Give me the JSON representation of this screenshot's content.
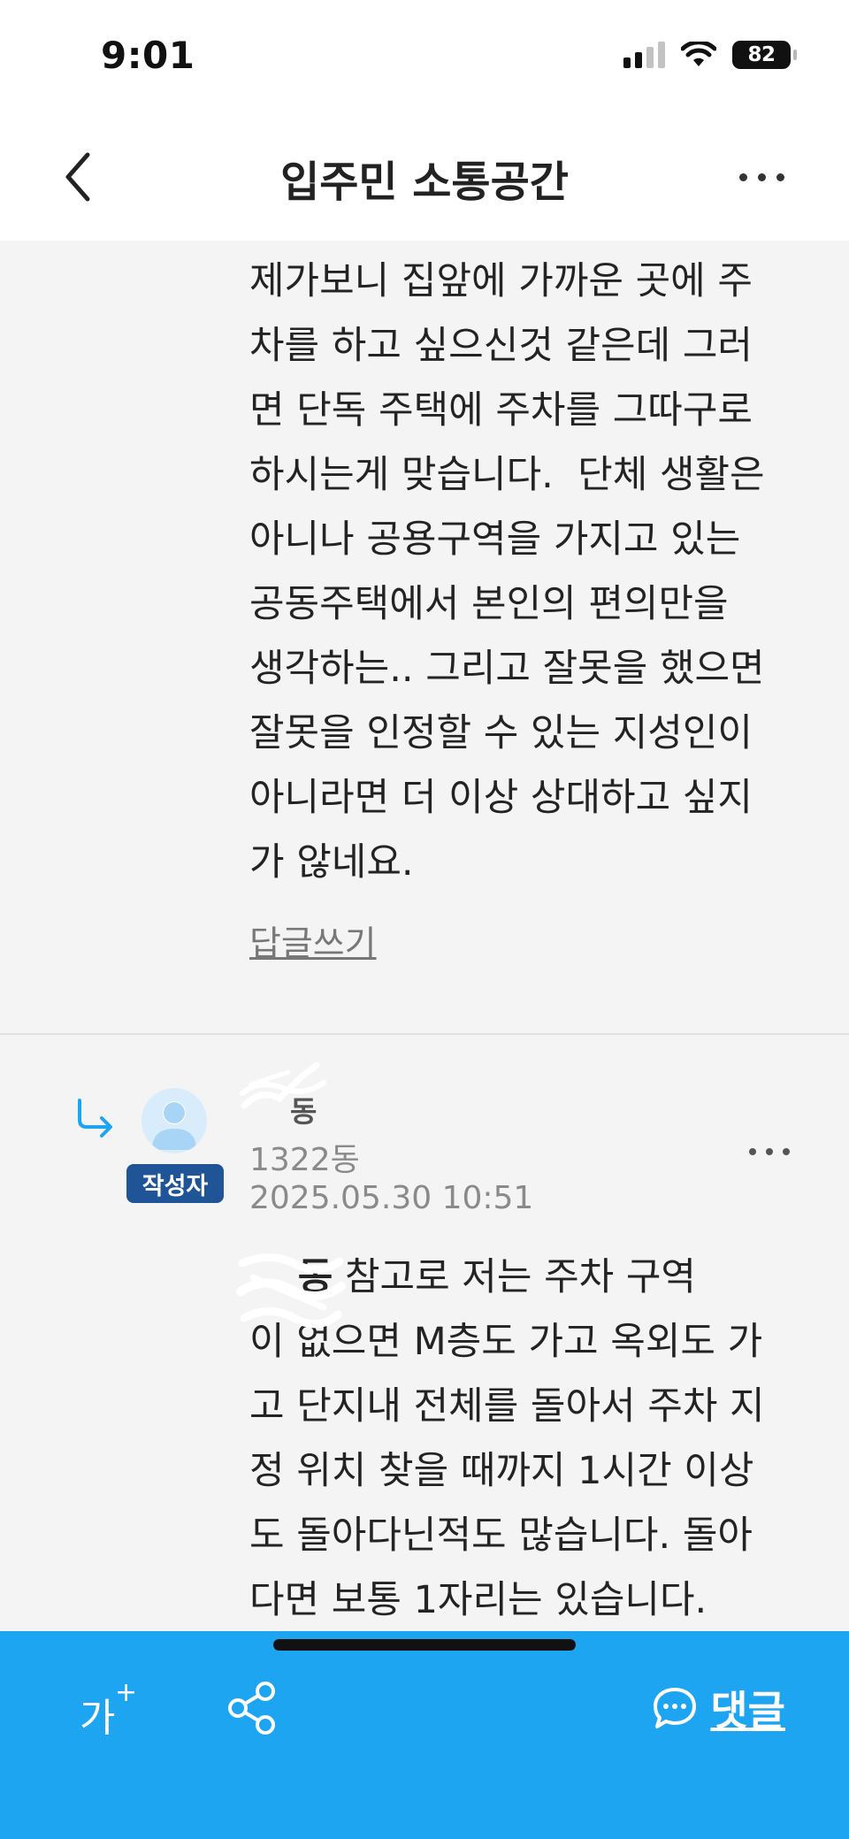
{
  "status_bar": {
    "time": "9:01",
    "battery": "82",
    "icons": [
      "signal-icon",
      "wifi-icon",
      "battery-icon"
    ]
  },
  "nav": {
    "title": "입주민 소통공간",
    "back_icon": "chevron-left-icon",
    "more_icon": "more-horizontal-icon"
  },
  "comments": [
    {
      "text": "제가보니 집앞에 가까운 곳에 주\n차를 하고 싶으신것 같은데 그러\n면 단독 주택에 주차를 그따구로\n하시는게 맞습니다.  단체 생활은\n아니나 공용구역을 가지고 있는\n공동주택에서 본인의 편의만을\n생각하는.. 그리고 잘못을 했으면\n잘못을 인정할 수 있는 지성인이\n아니라면 더 이상 상대하고 싶지\n가 않네요.",
      "reply_label": "답글쓰기"
    },
    {
      "author_name": "동",
      "author_badge": "작성자",
      "dong": "1322동",
      "date": "2025.05.30 10:51",
      "mention": "동",
      "text": " 참고로 저는 주차 구역\n이 없으면 M층도 가고 옥외도 가\n고 단지내 전체를 돌아서 주차 지\n정 위치 찾을 때까지 1시간 이상\n도 돌아다닌적도 많습니다. 돌아\n다면 보통 1자리는 있습니다."
    }
  ],
  "bottom_bar": {
    "font_size_label": "가",
    "font_size_plus": "+",
    "comment_label": "댓글",
    "icons": [
      "font-size-icon",
      "share-icon",
      "chat-bubble-icon"
    ]
  },
  "colors": {
    "accent": "#1ea5f2",
    "badge": "#1f5597",
    "background": "#f4f4f5",
    "reply_arrow": "#1ea5f2"
  }
}
